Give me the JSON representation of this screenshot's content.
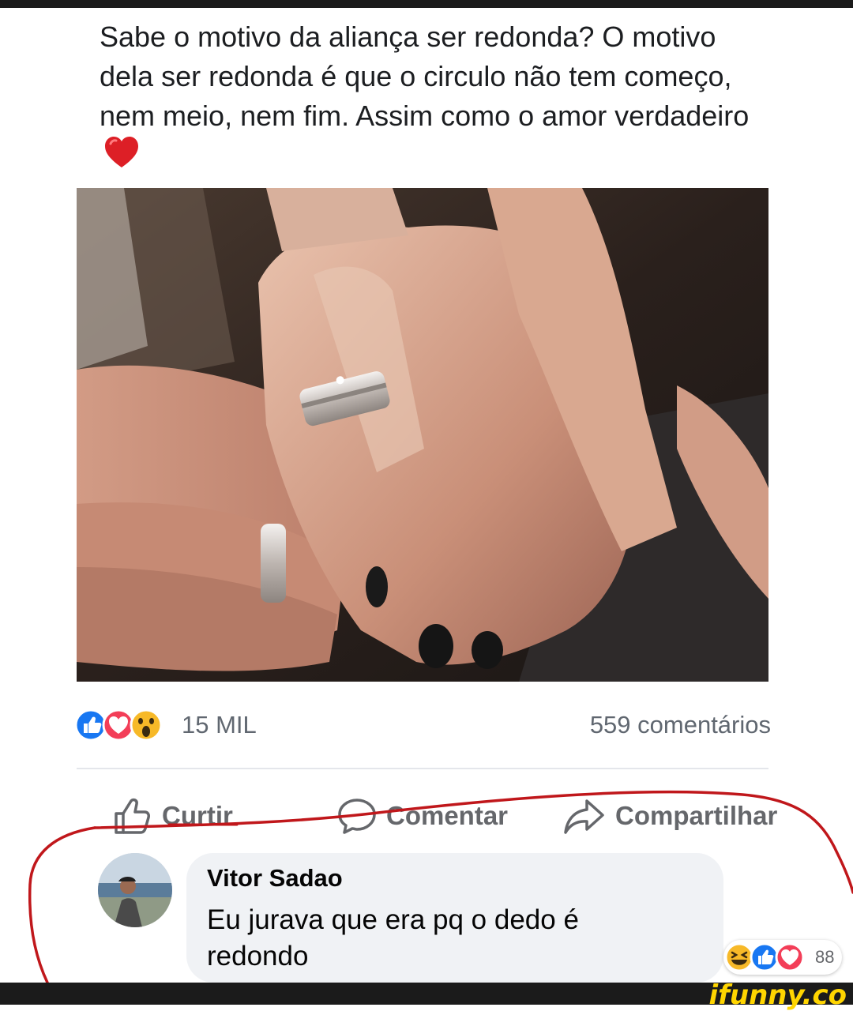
{
  "post": {
    "text": "Sabe o motivo da aliança ser redonda? O motivo dela ser redonda é que o circulo não tem começo, nem meio, nem fim. Assim como o amor verdadeiro",
    "emoji": "red-heart-emoji"
  },
  "reactions": {
    "icons": [
      "like-icon",
      "love-icon",
      "wow-icon"
    ],
    "count": "15 MIL",
    "comments": "559 comentários"
  },
  "actions": {
    "like": "Curtir",
    "comment": "Comentar",
    "share": "Compartilhar"
  },
  "comment": {
    "author": "Vitor Sadao",
    "text": "Eu jurava que era pq o dedo é redondo",
    "reaction_icons": [
      "haha-icon",
      "like-icon",
      "love-icon"
    ],
    "reaction_count": "88"
  },
  "colors": {
    "like_blue": "#1877f2",
    "love_red": "#f33e58",
    "wow_yellow": "#f7b928",
    "annotation_red": "#c0171b",
    "watermark_yellow": "#ffd500"
  },
  "watermark": "ifunny.co"
}
